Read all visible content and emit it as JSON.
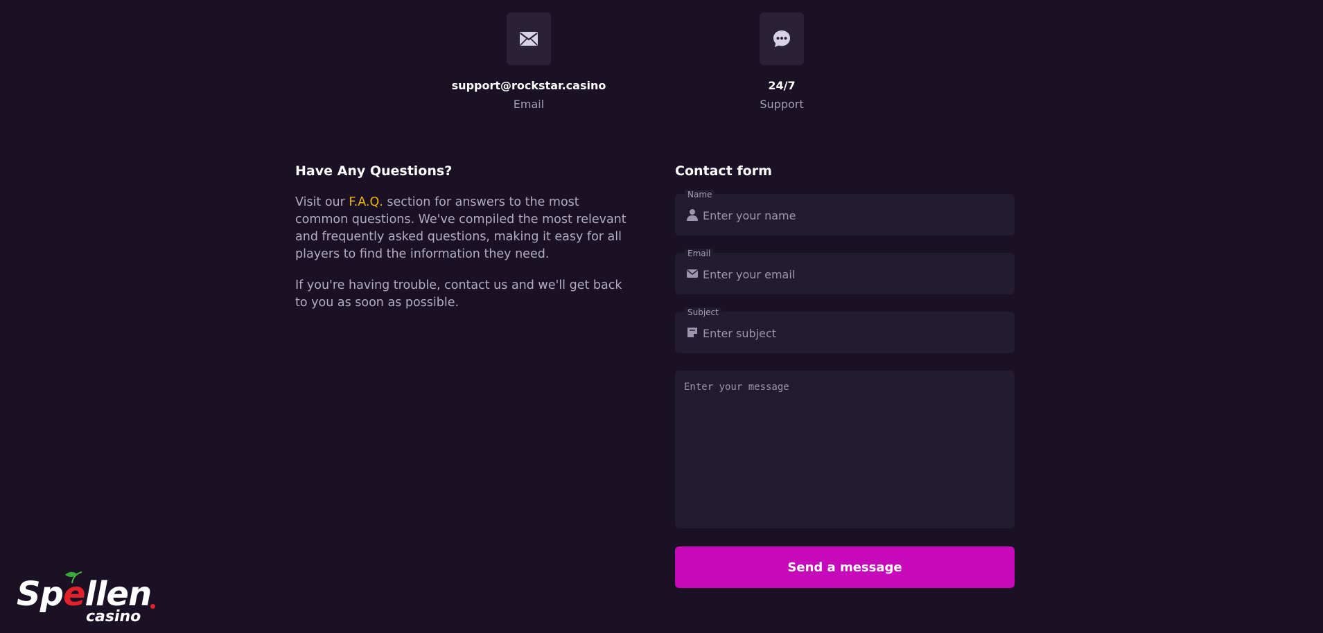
{
  "contact_cards": {
    "email": {
      "value": "support@rockstar.casino",
      "label": "Email",
      "icon": "envelope-icon"
    },
    "support": {
      "value": "24/7",
      "label": "Support",
      "icon": "chat-icon"
    }
  },
  "faq": {
    "heading": "Have Any Questions?",
    "paragraph1_prefix": "Visit our ",
    "paragraph1_link": "F.A.Q.",
    "paragraph1_suffix": " section for answers to the most common questions. We've compiled the most relevant and frequently asked questions, making it easy for all players to find the information they need.",
    "paragraph2": "If you're having trouble, contact us and we'll get back to you as soon as possible."
  },
  "form": {
    "heading": "Contact form",
    "name": {
      "label": "Name",
      "placeholder": "Enter your name",
      "icon": "user-icon"
    },
    "email": {
      "label": "Email",
      "placeholder": "Enter your email",
      "icon": "envelope-icon"
    },
    "subject": {
      "label": "Subject",
      "placeholder": "Enter subject",
      "icon": "note-icon"
    },
    "message": {
      "placeholder": "Enter your message"
    },
    "submit_label": "Send a message"
  },
  "logo": {
    "main": "Spellen",
    "main_start": "Sp",
    "main_e": "e",
    "main_end": "llen",
    "sub": "casino"
  },
  "colors": {
    "background": "#1a1224",
    "accent": "#c70ab9",
    "link": "#f2b705",
    "logo_red": "#e3212b"
  }
}
